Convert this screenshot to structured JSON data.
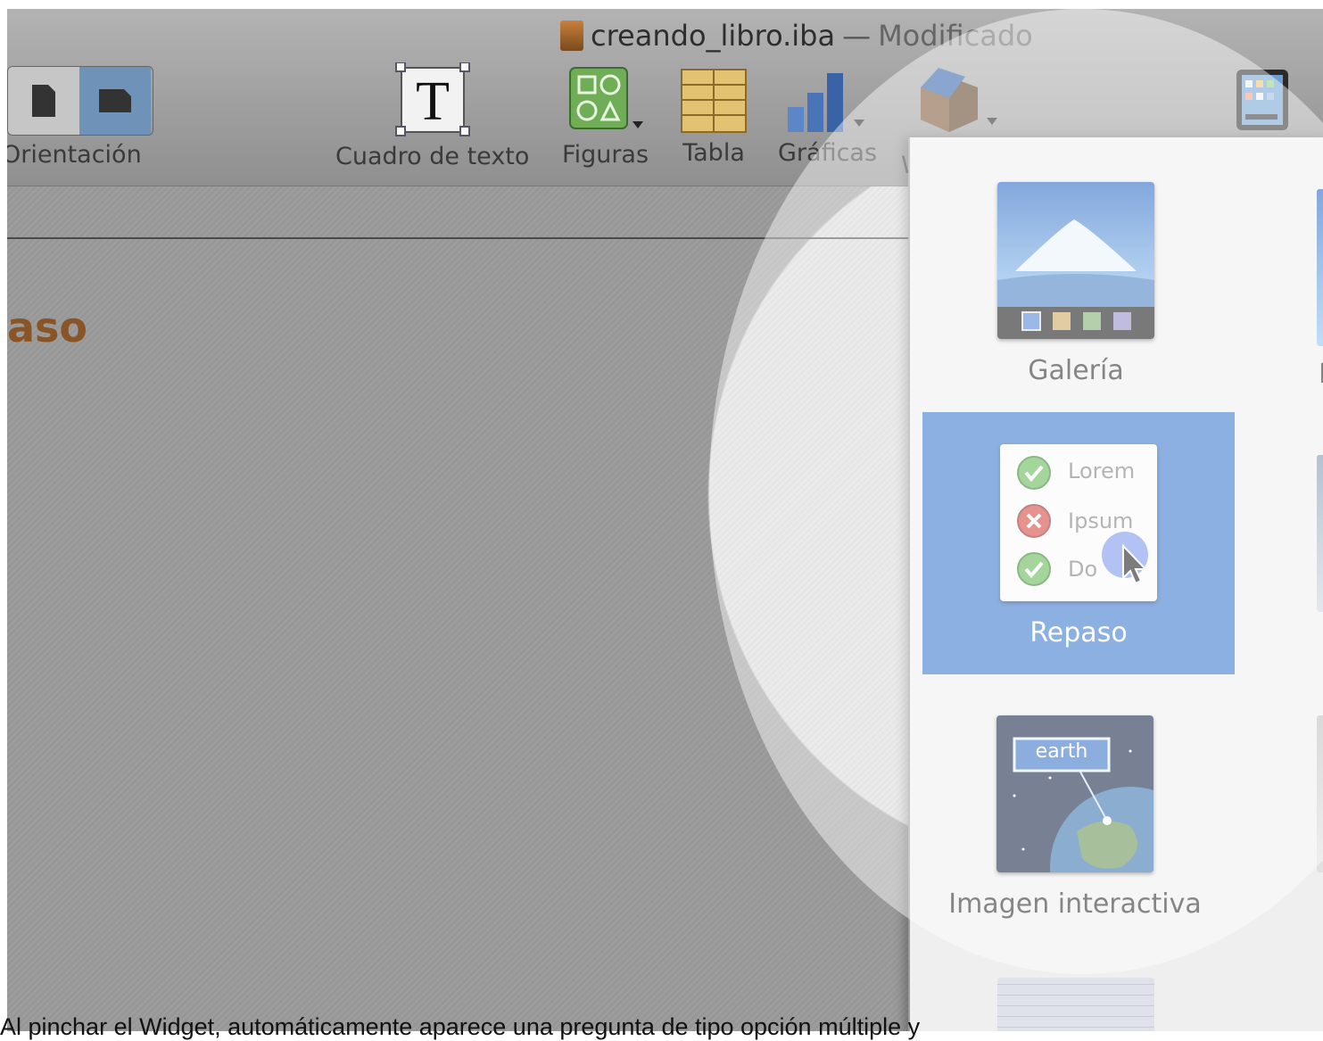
{
  "window": {
    "title": "creando_libro.iba",
    "separator": "—",
    "status": "Modificado"
  },
  "toolbar": {
    "orientation_label": "Orientación",
    "textbox_label": "Cuadro de texto",
    "shapes_label": "Figuras",
    "table_label": "Tabla",
    "charts_label": "Gráficas",
    "widgets_label_partial": "W"
  },
  "document": {
    "heading_fragment": "aso"
  },
  "widget_menu": {
    "items": [
      {
        "label": "Galería",
        "icon": "gallery-thumbnail"
      },
      {
        "label": "Repaso",
        "icon": "review-thumbnail",
        "selected": true
      },
      {
        "label": "Imagen interactiva",
        "icon": "interactive-image-thumbnail"
      }
    ],
    "right_column_partial_label": "M",
    "review_thumb": {
      "line1": "Lorem",
      "line2": "Ipsum",
      "line3": "Do"
    },
    "interactive_thumb_label": "earth",
    "selected_color": "#2d6fc9"
  },
  "caption": {
    "text": "Al pinchar el Widget, automáticamente aparece una pregunta de tipo opción múltiple y"
  }
}
